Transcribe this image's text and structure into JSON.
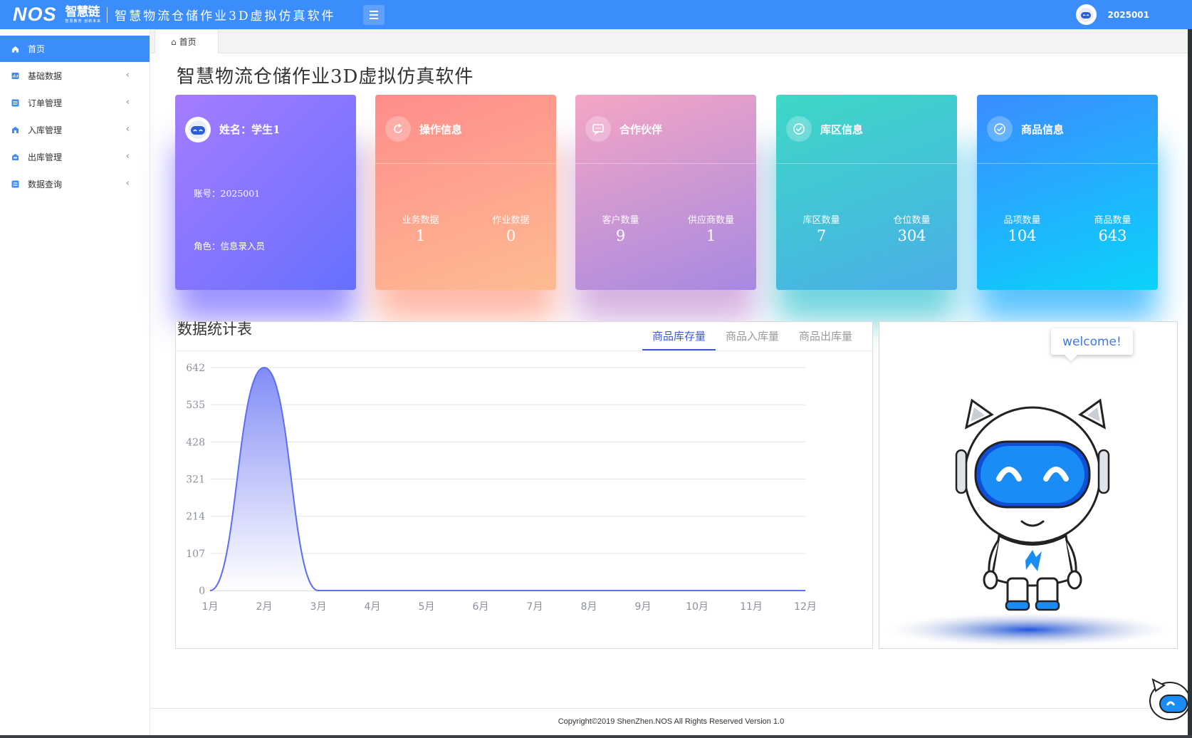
{
  "header": {
    "logo_text": "NOS",
    "logo_sub_main": "智慧链",
    "logo_sub_small": "智慧教育 创新未来",
    "app_title": "智慧物流仓储作业3D虚拟仿真软件",
    "username": "2025001"
  },
  "sidebar": {
    "items": [
      {
        "label": "首页",
        "icon": "home-icon",
        "active": true
      },
      {
        "label": "基础数据",
        "icon": "dashboard-icon"
      },
      {
        "label": "订单管理",
        "icon": "list-icon"
      },
      {
        "label": "入库管理",
        "icon": "inbound-icon"
      },
      {
        "label": "出库管理",
        "icon": "outbound-icon"
      },
      {
        "label": "数据查询",
        "icon": "database-icon"
      }
    ]
  },
  "tabs": [
    {
      "label": "首页"
    }
  ],
  "page_title": "智慧物流仓储作业3D虚拟仿真软件",
  "cards": {
    "user": {
      "title": "姓名：学生1",
      "account": "账号：2025001",
      "role": "角色：信息录入员"
    },
    "operation": {
      "title": "操作信息",
      "stats": [
        {
          "label": "业务数据",
          "value": "1"
        },
        {
          "label": "作业数据",
          "value": "0"
        }
      ]
    },
    "partner": {
      "title": "合作伙伴",
      "stats": [
        {
          "label": "客户数量",
          "value": "9"
        },
        {
          "label": "供应商数量",
          "value": "1"
        }
      ]
    },
    "zone": {
      "title": "库区信息",
      "stats": [
        {
          "label": "库区数量",
          "value": "7"
        },
        {
          "label": "仓位数量",
          "value": "304"
        }
      ]
    },
    "goods": {
      "title": "商品信息",
      "stats": [
        {
          "label": "品项数量",
          "value": "104"
        },
        {
          "label": "商品数量",
          "value": "643"
        }
      ]
    }
  },
  "stats_panel": {
    "title": "数据统计表",
    "tabs": [
      "商品库存量",
      "商品入库量",
      "商品出库量"
    ],
    "active_tab": 0
  },
  "chart_data": {
    "type": "area",
    "categories": [
      "1月",
      "2月",
      "3月",
      "4月",
      "5月",
      "6月",
      "7月",
      "8月",
      "9月",
      "10月",
      "11月",
      "12月"
    ],
    "series": [
      {
        "values": [
          0,
          642,
          0,
          0,
          0,
          0,
          0,
          0,
          0,
          0,
          0,
          0
        ]
      }
    ],
    "yticks": [
      0,
      107,
      214,
      321,
      428,
      535,
      642
    ],
    "ylim": [
      0,
      642
    ],
    "grid": true,
    "colors": {
      "line": "#5b6ef5",
      "fill_top": "#7b86f5",
      "fill_bottom": "#ffffff"
    }
  },
  "robot": {
    "welcome": "welcome!"
  },
  "footer": "Copyright©2019 ShenZhen.NOS All Rights Reserved Version 1.0"
}
